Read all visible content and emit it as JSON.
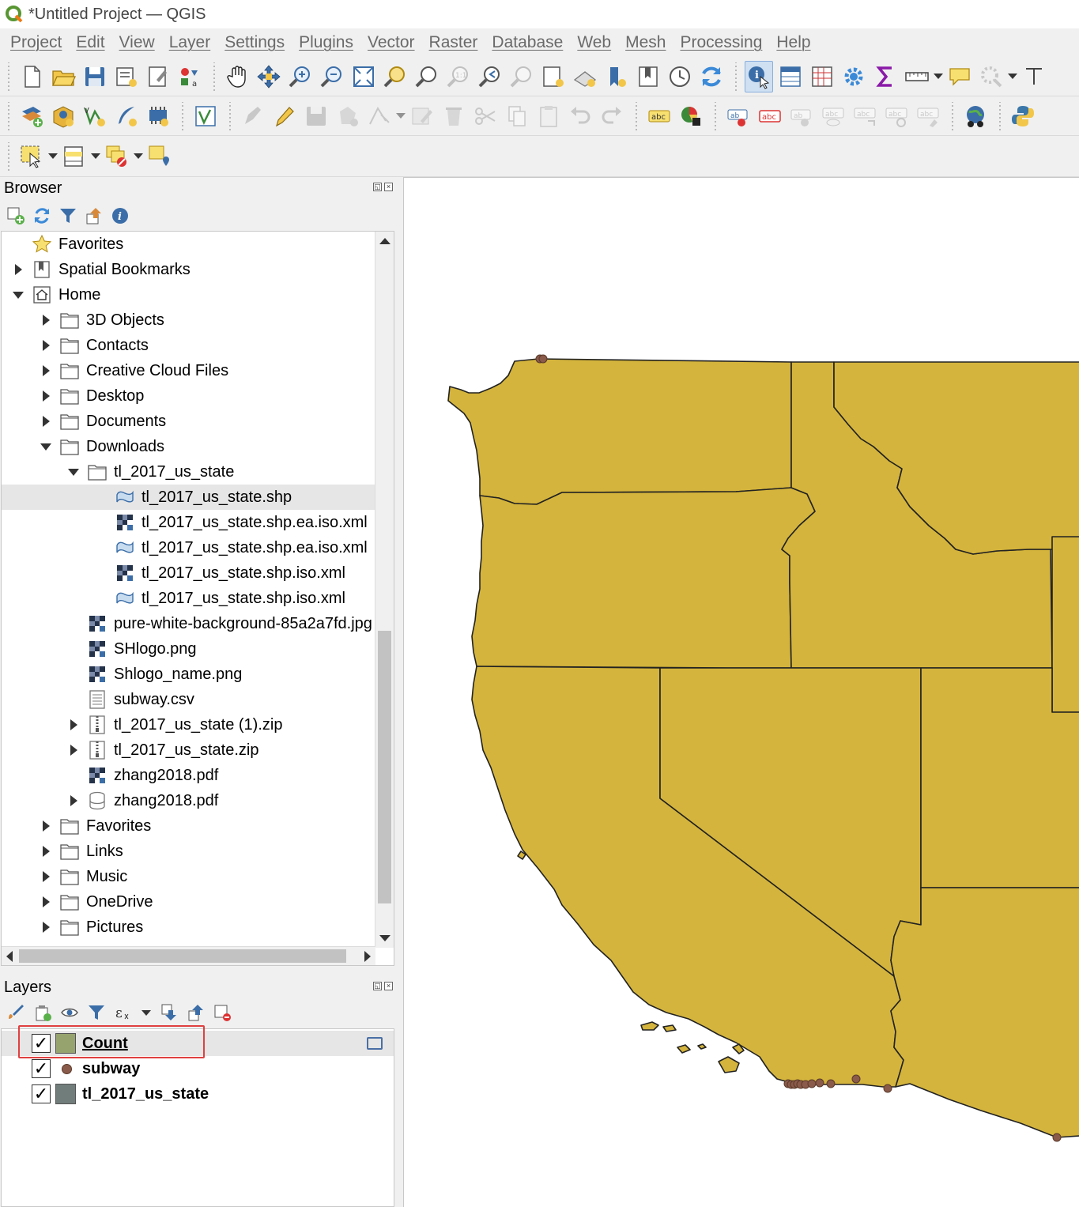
{
  "window": {
    "title": "*Untitled Project — QGIS"
  },
  "menu": [
    "Project",
    "Edit",
    "View",
    "Layer",
    "Settings",
    "Plugins",
    "Vector",
    "Raster",
    "Database",
    "Web",
    "Mesh",
    "Processing",
    "Help"
  ],
  "browser": {
    "title": "Browser",
    "items": [
      {
        "label": "Favorites",
        "icon": "star-icon",
        "depth": 0,
        "expander": "none"
      },
      {
        "label": "Spatial Bookmarks",
        "icon": "bookmark-icon",
        "depth": 0,
        "expander": "closed"
      },
      {
        "label": "Home",
        "icon": "home-icon",
        "depth": 0,
        "expander": "open"
      },
      {
        "label": "3D Objects",
        "icon": "folder-icon",
        "depth": 1,
        "expander": "closed"
      },
      {
        "label": "Contacts",
        "icon": "folder-icon",
        "depth": 1,
        "expander": "closed"
      },
      {
        "label": "Creative Cloud Files",
        "icon": "folder-icon",
        "depth": 1,
        "expander": "closed"
      },
      {
        "label": "Desktop",
        "icon": "folder-icon",
        "depth": 1,
        "expander": "closed"
      },
      {
        "label": "Documents",
        "icon": "folder-icon",
        "depth": 1,
        "expander": "closed"
      },
      {
        "label": "Downloads",
        "icon": "folder-icon",
        "depth": 1,
        "expander": "open"
      },
      {
        "label": "tl_2017_us_state",
        "icon": "folder-icon",
        "depth": 2,
        "expander": "open"
      },
      {
        "label": "tl_2017_us_state.shp",
        "icon": "polygon-layer-icon",
        "depth": 3,
        "expander": "none",
        "selected": true
      },
      {
        "label": "tl_2017_us_state.shp.ea.iso.xml",
        "icon": "raster-icon",
        "depth": 3,
        "expander": "none"
      },
      {
        "label": "tl_2017_us_state.shp.ea.iso.xml",
        "icon": "polygon-layer-icon",
        "depth": 3,
        "expander": "none"
      },
      {
        "label": "tl_2017_us_state.shp.iso.xml",
        "icon": "raster-icon",
        "depth": 3,
        "expander": "none"
      },
      {
        "label": "tl_2017_us_state.shp.iso.xml",
        "icon": "polygon-layer-icon",
        "depth": 3,
        "expander": "none"
      },
      {
        "label": "pure-white-background-85a2a7fd.jpg",
        "icon": "raster-icon",
        "depth": 2,
        "expander": "none"
      },
      {
        "label": "SHlogo.png",
        "icon": "raster-icon",
        "depth": 2,
        "expander": "none"
      },
      {
        "label": "Shlogo_name.png",
        "icon": "raster-icon",
        "depth": 2,
        "expander": "none"
      },
      {
        "label": "subway.csv",
        "icon": "table-icon",
        "depth": 2,
        "expander": "none"
      },
      {
        "label": "tl_2017_us_state (1).zip",
        "icon": "zip-icon",
        "depth": 2,
        "expander": "closed"
      },
      {
        "label": "tl_2017_us_state.zip",
        "icon": "zip-icon",
        "depth": 2,
        "expander": "closed"
      },
      {
        "label": "zhang2018.pdf",
        "icon": "raster-icon",
        "depth": 2,
        "expander": "none"
      },
      {
        "label": "zhang2018.pdf",
        "icon": "database-icon",
        "depth": 2,
        "expander": "closed"
      },
      {
        "label": "Favorites",
        "icon": "folder-icon",
        "depth": 1,
        "expander": "closed"
      },
      {
        "label": "Links",
        "icon": "folder-icon",
        "depth": 1,
        "expander": "closed"
      },
      {
        "label": "Music",
        "icon": "folder-icon",
        "depth": 1,
        "expander": "closed"
      },
      {
        "label": "OneDrive",
        "icon": "folder-icon",
        "depth": 1,
        "expander": "closed"
      },
      {
        "label": "Pictures",
        "icon": "folder-icon",
        "depth": 1,
        "expander": "closed"
      }
    ]
  },
  "layers": {
    "title": "Layers",
    "items": [
      {
        "name": "Count",
        "checked": true,
        "symbol": "polygon",
        "color": "#97a36f",
        "selected": true,
        "underline": true
      },
      {
        "name": "subway",
        "checked": true,
        "symbol": "point",
        "color": "#8a5a4a"
      },
      {
        "name": "tl_2017_us_state",
        "checked": true,
        "symbol": "polygon",
        "color": "#717d7b"
      }
    ]
  },
  "map": {
    "fill_color": "#d4b43c",
    "stroke_color": "#222222",
    "point_color": "#8a5a4a",
    "background": "#ffffff"
  },
  "colors": {
    "selection_highlight": "#e04040",
    "qgis_green": "#589632"
  }
}
